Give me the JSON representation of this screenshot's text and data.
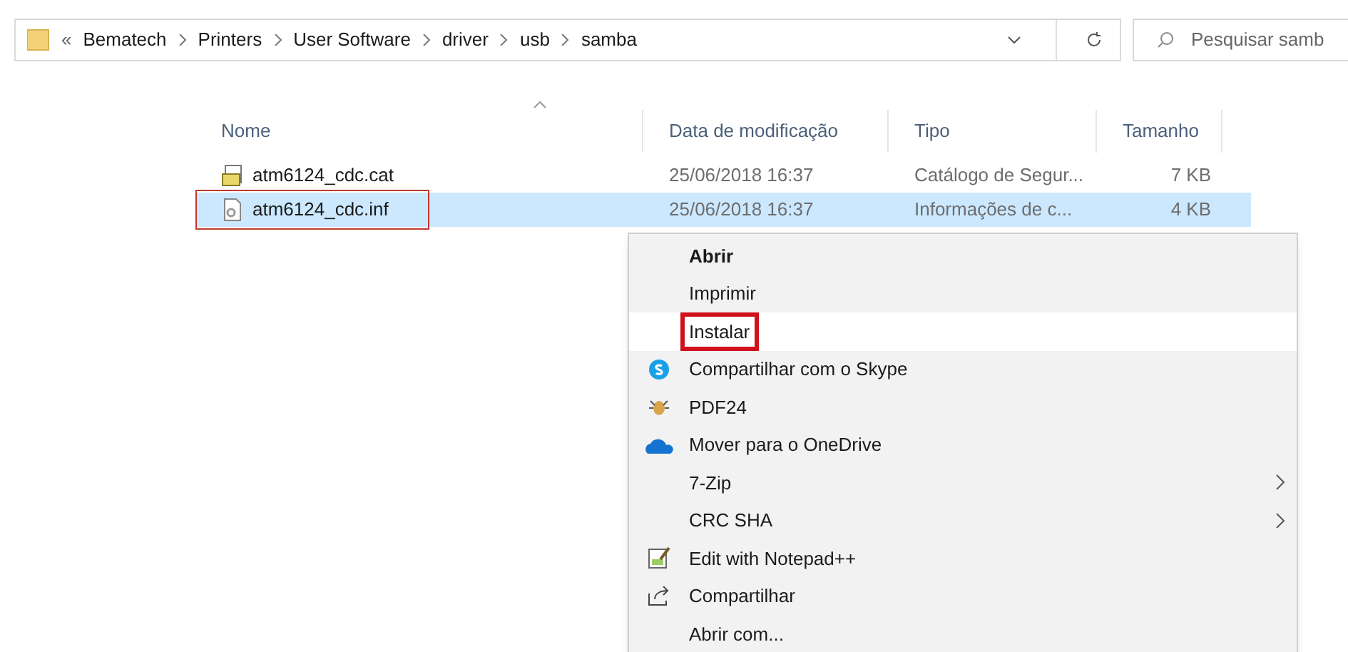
{
  "address_bar": {
    "overflow": "«",
    "breadcrumbs": [
      "Bematech",
      "Printers",
      "User Software",
      "driver",
      "usb",
      "samba"
    ]
  },
  "search": {
    "placeholder": "Pesquisar samb"
  },
  "table": {
    "columns": [
      "Nome",
      "Data de modificação",
      "Tipo",
      "Tamanho"
    ],
    "rows": [
      {
        "kind": "catalog",
        "name": "atm6124_cdc.cat",
        "modified": "25/06/2018 16:37",
        "type": "Catálogo de Segur...",
        "size": "7 KB",
        "selected": false,
        "outlined": false
      },
      {
        "kind": "setup",
        "name": "atm6124_cdc.inf",
        "modified": "25/06/2018 16:37",
        "type": "Informações de c...",
        "size": "4 KB",
        "selected": true,
        "outlined": true
      }
    ]
  },
  "context_menu": {
    "items": [
      {
        "label": "Abrir",
        "default": true,
        "selected": false,
        "outlined": false,
        "submenu": false
      },
      {
        "label": "Imprimir",
        "default": false,
        "selected": false,
        "outlined": false,
        "submenu": false
      },
      {
        "label": "Instalar",
        "default": false,
        "selected": true,
        "outlined": true,
        "submenu": false
      },
      {
        "label": "Compartilhar com o Skype",
        "default": false,
        "selected": false,
        "outlined": false,
        "submenu": false
      },
      {
        "label": "PDF24",
        "default": false,
        "selected": false,
        "outlined": false,
        "submenu": false
      },
      {
        "label": "Mover para o OneDrive",
        "default": false,
        "selected": false,
        "outlined": false,
        "submenu": false
      },
      {
        "label": "7-Zip",
        "default": false,
        "selected": false,
        "outlined": false,
        "submenu": true
      },
      {
        "label": "CRC SHA",
        "default": false,
        "selected": false,
        "outlined": false,
        "submenu": true
      },
      {
        "label": "Edit with Notepad++",
        "default": false,
        "selected": false,
        "outlined": false,
        "submenu": false
      },
      {
        "label": "Compartilhar",
        "default": false,
        "selected": false,
        "outlined": false,
        "submenu": false
      },
      {
        "label": "Abrir com...",
        "default": false,
        "selected": false,
        "outlined": false,
        "submenu": false
      }
    ]
  }
}
